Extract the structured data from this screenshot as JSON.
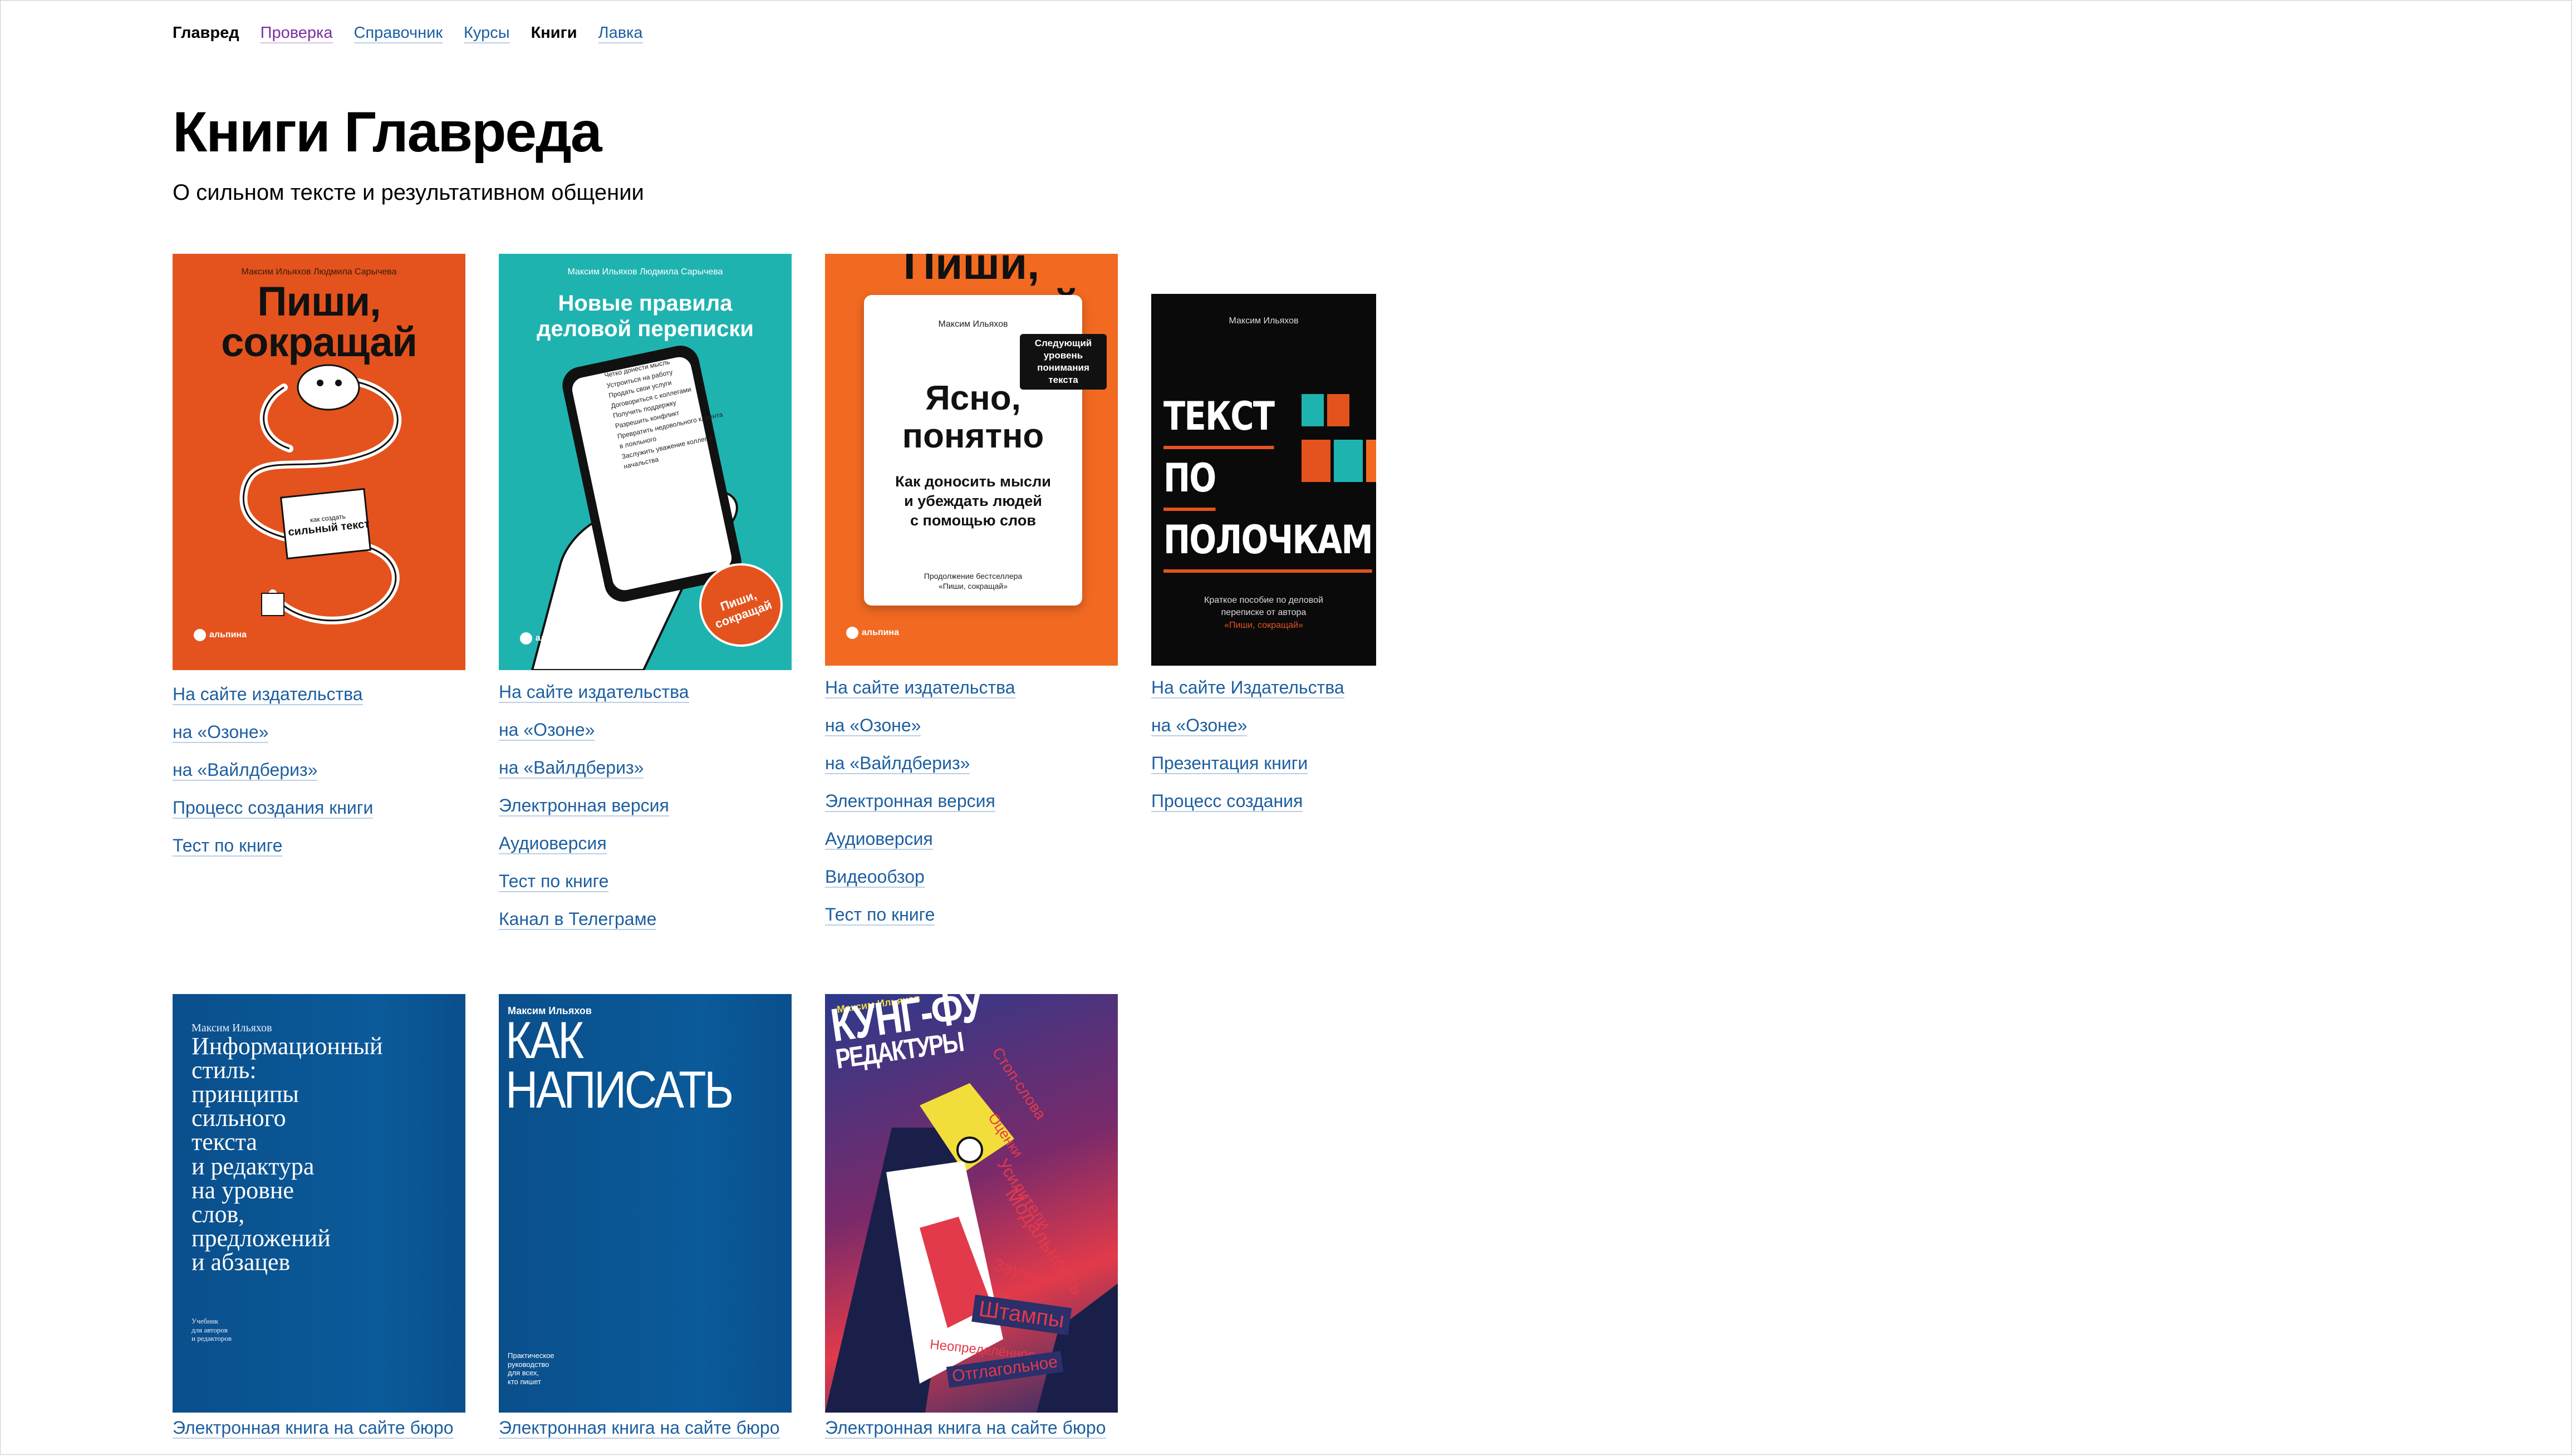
{
  "nav": [
    {
      "label": "Главред",
      "state": "current"
    },
    {
      "label": "Проверка",
      "state": "visited"
    },
    {
      "label": "Справочник",
      "state": "link"
    },
    {
      "label": "Курсы",
      "state": "link"
    },
    {
      "label": "Книги",
      "state": "current"
    },
    {
      "label": "Лавка",
      "state": "link"
    }
  ],
  "page": {
    "title": "Книги Главреда",
    "subtitle": "О сильном тексте и результативном общении"
  },
  "colors": {
    "link": "#1d5fa0",
    "visited": "#7b2fa0",
    "orange": "#e4531d",
    "teal": "#1fb3b0",
    "blue": "#0b4f8a"
  },
  "books": [
    {
      "cover": {
        "authors": "Максим Ильяхов   Людмила Сарычева",
        "title_l1": "Пиши,",
        "title_l2": "сокращай",
        "tagline_top": "как создать",
        "tagline_main": "сильный текст",
        "publisher": "альпина"
      },
      "links": [
        "На сайте издательства",
        "на «Озоне»",
        "на «Вайлдбериз»",
        "Процесс создания книги",
        "Тест по книге"
      ]
    },
    {
      "cover": {
        "authors": "Максим Ильяхов   Людмила Сарычева",
        "title_l1": "Новые правила",
        "title_l2": "деловой переписки",
        "phone_items": [
          "Четко донести мысль",
          "Устроиться на работу",
          "Продать свои услуги",
          "Договориться с коллегами",
          "Получить поддержку",
          "Разрешить конфликт",
          "Превратить недовольного клиента в лояльного",
          "Заслужить уважение коллег и начальства"
        ],
        "badge": "Пиши, сокращай",
        "publisher": "альпина"
      },
      "links": [
        "На сайте издательства",
        "на «Озоне»",
        "на «Вайлдбериз»",
        "Электронная версия",
        "Аудиоверсия",
        "Тест по книге",
        "Канал в Телеграме"
      ]
    },
    {
      "cover": {
        "bg_title": "Пиши, сокращай",
        "author": "Максим Ильяхов",
        "sticker_l1": "Следующий",
        "sticker_l2": "уровень",
        "sticker_l3": "понимания",
        "sticker_l4": "текста",
        "title_l1": "Ясно,",
        "title_l2": "понятно",
        "sub_l1": "Как доносить мысли",
        "sub_l2": "и убеждать людей",
        "sub_l3": "с помощью слов",
        "foot_l1": "Продолжение бестселлера",
        "foot_l2": "«Пиши, сокращай»",
        "publisher": "альпина"
      },
      "links": [
        "На сайте издательства",
        "на «Озоне»",
        "на «Вайлдбериз»",
        "Электронная версия",
        "Аудиоверсия",
        "Видеообзор",
        "Тест по книге"
      ]
    },
    {
      "cover": {
        "author": "Максим Ильяхов",
        "title_l1": "ТЕКСТ",
        "title_l2": "ПО",
        "title_l3": "ПОЛОЧКАМ",
        "foot_l1": "Краткое пособие по деловой",
        "foot_l2": "переписке от автора",
        "foot_l3": "«Пиши, сокращай»"
      },
      "links": [
        "На сайте Издательства",
        "на «Озоне»",
        "Презентация книги",
        "Процесс создания"
      ]
    },
    {
      "cover": {
        "author": "Максим Ильяхов",
        "title_lines": [
          "Информационный",
          "стиль:",
          "принципы",
          "сильного",
          "текста",
          "и редактура",
          "на уровне",
          "слов,",
          "предложений",
          "и абзацев"
        ],
        "foot_l1": "Учебник",
        "foot_l2": "для авторов",
        "foot_l3": "и редакторов"
      },
      "links": [
        "Электронная книга на сайте бюро"
      ]
    },
    {
      "cover": {
        "author": "Максим Ильяхов",
        "title_l1": "КАК",
        "title_l2": "НАПИСАТЬ",
        "foot_l1": "Практическое",
        "foot_l2": "руководство",
        "foot_l3": "для всех,",
        "foot_l4": "кто пишет"
      },
      "links": [
        "Электронная книга на сайте бюро"
      ]
    },
    {
      "cover": {
        "author": "Максим Ильяхов",
        "title_l1": "КУНГ-ФУ",
        "title_l2": "РЕДАКТУРЫ",
        "tags": [
          "Стоп-слова",
          "Оценки",
          "Усилители",
          "Модальность",
          "Заумь",
          "Штампы",
          "Неопределённое",
          "Отглагольное"
        ]
      },
      "links": [
        "Электронная книга на сайте бюро"
      ]
    }
  ]
}
